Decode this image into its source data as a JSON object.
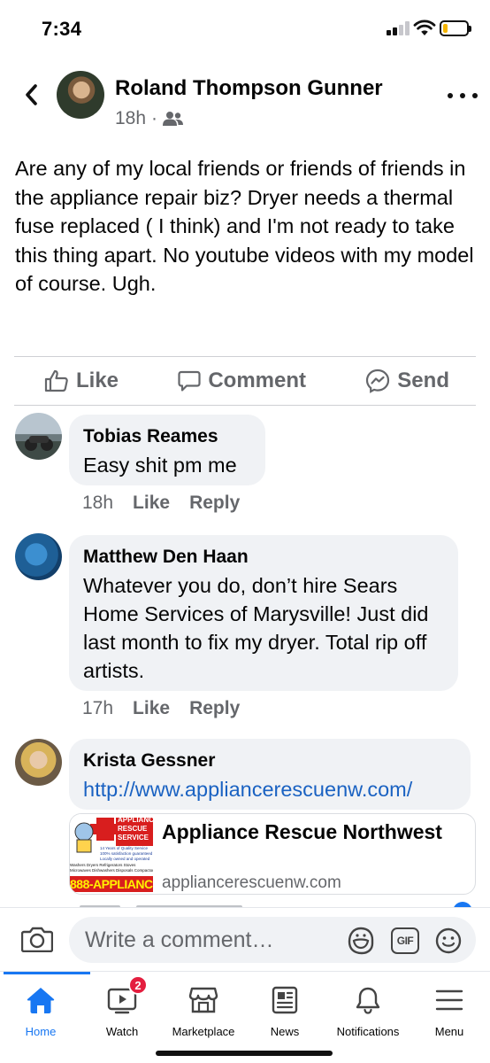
{
  "status_bar": {
    "time": "7:34",
    "battery_level": 0.2,
    "signal_bars_active": 2
  },
  "post": {
    "author": "Roland Thompson Gunner",
    "time_ago": "18h",
    "separator": "·",
    "audience_icon": "friends-icon",
    "text": "Are any of my local friends or friends of friends in the appliance repair biz? Dryer needs a thermal fuse replaced ( I think) and I'm not ready to take this thing apart. No youtube videos with my model of course. Ugh."
  },
  "actions": {
    "like": "Like",
    "comment": "Comment",
    "send": "Send"
  },
  "comments": [
    {
      "name": "Tobias Reames",
      "text": "Easy shit pm me",
      "time": "18h",
      "like": "Like",
      "reply": "Reply"
    },
    {
      "name": "Matthew Den Haan",
      "text": "Whatever you do, don’t hire Sears Home Services of Marysville! Just did last month to fix my dryer. Total rip off artists.",
      "time": "17h",
      "like": "Like",
      "reply": "Reply"
    },
    {
      "name": "Krista Gessner",
      "link": "http://www.appliancerescuenw.com/"
    }
  ],
  "link_card": {
    "title": "Appliance Rescue Northwest",
    "domain": "appliancerescuenw.com",
    "thumb_text": [
      "APPLIANCE",
      "RESCUE",
      "SERVICE",
      "14 Years of Quality Service",
      "100% satisfaction guaranteed",
      "Locally owned and operated",
      "Washers Dryers Refrigerators Stoves",
      "Microwaves Dishwashers Disposals Compactors",
      "888-APPLIANCE"
    ]
  },
  "composer": {
    "placeholder": "Write a comment…",
    "gif_label": "GIF"
  },
  "tabbar": {
    "tabs": [
      {
        "label": "Home",
        "icon": "home-icon",
        "active": true
      },
      {
        "label": "Watch",
        "icon": "watch-icon",
        "badge": "2"
      },
      {
        "label": "Marketplace",
        "icon": "marketplace-icon"
      },
      {
        "label": "News",
        "icon": "news-icon"
      },
      {
        "label": "Notifications",
        "icon": "bell-icon"
      },
      {
        "label": "Menu",
        "icon": "menu-icon"
      }
    ]
  },
  "colors": {
    "accent": "#1877f2",
    "link": "#1a62c2",
    "muted": "#65676b",
    "bubble": "#f0f2f5",
    "badge": "#e41e3f"
  }
}
